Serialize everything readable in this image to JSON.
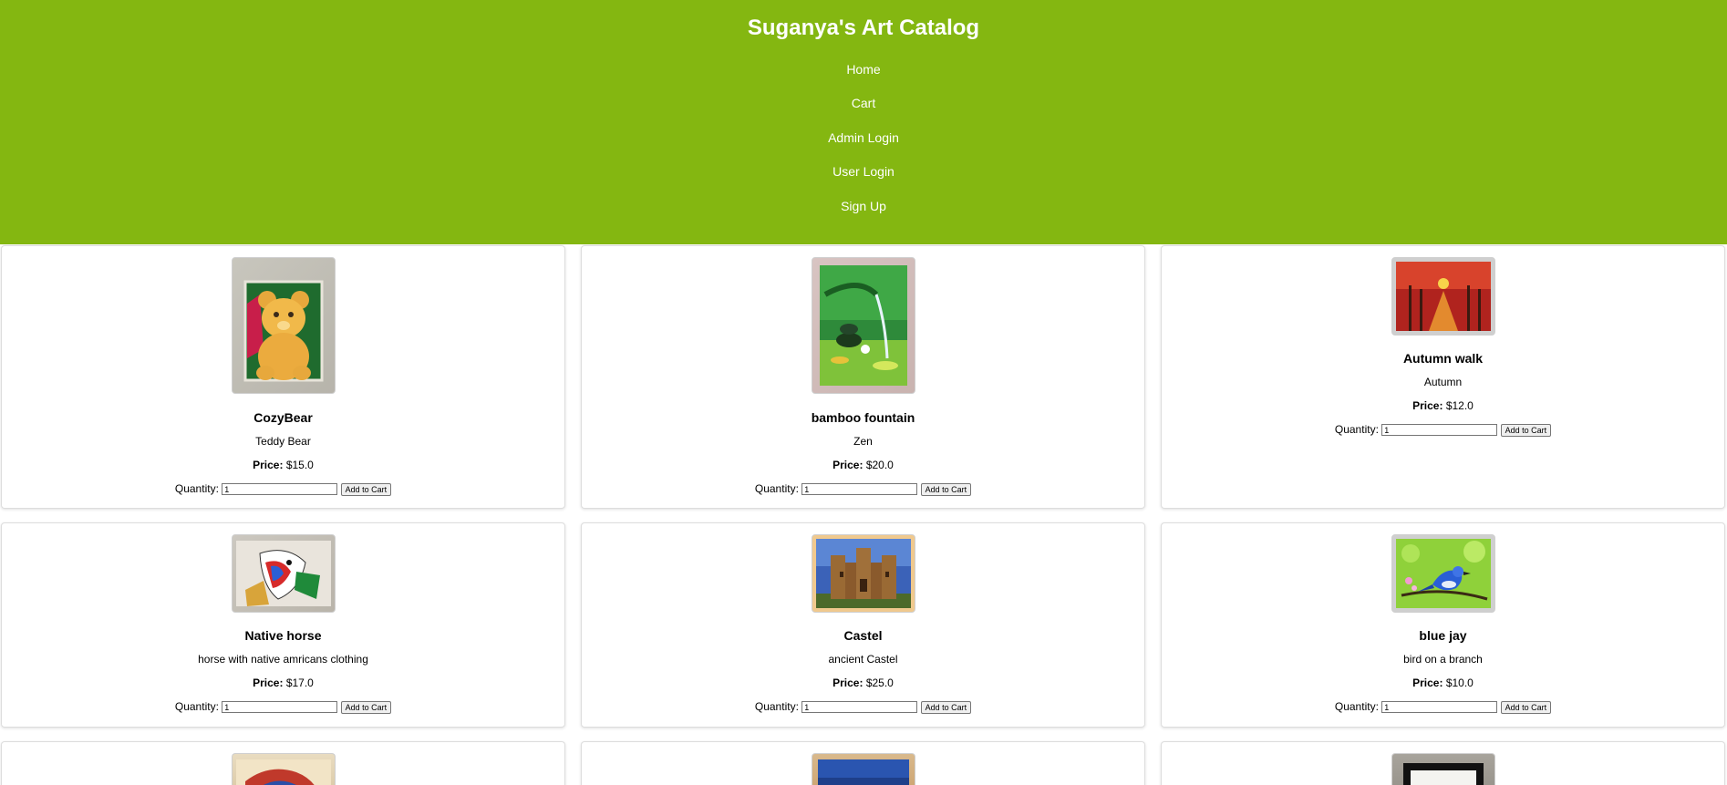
{
  "header": {
    "title": "Suganya's Art Catalog",
    "nav": [
      "Home",
      "Cart",
      "Admin Login",
      "User Login",
      "Sign Up"
    ]
  },
  "product_labels": {
    "price_label": "Price:",
    "quantity_label": "Quantity:",
    "add_to_cart": "Add to Cart"
  },
  "products": [
    {
      "name": "CozyBear",
      "description": "Teddy Bear",
      "price": "$15.0",
      "quantity": "1",
      "image": "teddy-bear-painting"
    },
    {
      "name": "bamboo fountain",
      "description": "Zen",
      "price": "$20.0",
      "quantity": "1",
      "image": "bamboo-fountain-painting"
    },
    {
      "name": "Autumn walk",
      "description": "Autumn",
      "price": "$12.0",
      "quantity": "1",
      "image": "autumn-path-painting"
    },
    {
      "name": "Native horse",
      "description": "horse with native amricans clothing",
      "price": "$17.0",
      "quantity": "1",
      "image": "native-horse-painting"
    },
    {
      "name": "Castel",
      "description": "ancient Castel",
      "price": "$25.0",
      "quantity": "1",
      "image": "castle-painting"
    },
    {
      "name": "blue jay",
      "description": "bird on a branch",
      "price": "$10.0",
      "quantity": "1",
      "image": "blue-jay-painting"
    }
  ],
  "colors": {
    "header_bg": "#84b711",
    "header_text": "#ffffff"
  }
}
